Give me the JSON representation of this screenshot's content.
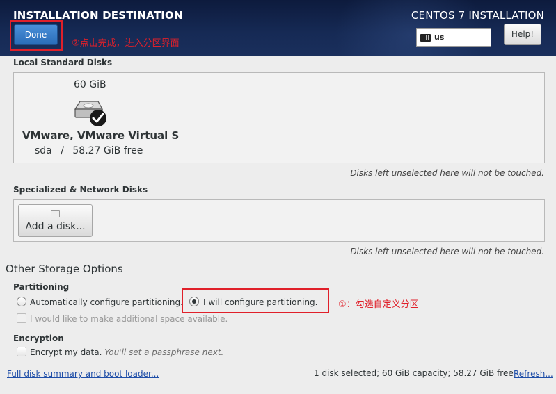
{
  "header": {
    "title": "INSTALLATION DESTINATION",
    "product": "CENTOS 7 INSTALLATION",
    "done_label": "Done",
    "done_annotation": "②点击完成，进入分区界面",
    "keyboard_layout": "us",
    "help_label": "Help!",
    "accent_color": "#e0202a"
  },
  "local_disks": {
    "section_label": "Local Standard Disks",
    "disk": {
      "size": "60 GiB",
      "name": "VMware, VMware Virtual S",
      "device": "sda",
      "separator": "/",
      "free": "58.27 GiB free",
      "icon": "harddisk-selected-icon"
    },
    "hint": "Disks left unselected here will not be touched."
  },
  "network_disks": {
    "section_label": "Specialized & Network Disks",
    "add_label": "Add a disk...",
    "hint": "Disks left unselected here will not be touched."
  },
  "other_options": {
    "title": "Other Storage Options",
    "partitioning": {
      "label": "Partitioning",
      "auto_label": "Automatically configure partitioning.",
      "manual_label": "I will configure partitioning.",
      "manual_annotation": "①：勾选自定义分区",
      "extra_space_label": "I would like to make additional space available.",
      "selected": "manual"
    },
    "encryption": {
      "label": "Encryption",
      "encrypt_label": "Encrypt my data.",
      "passphrase_hint": "You'll set a passphrase next."
    }
  },
  "footer": {
    "summary_link": "Full disk summary and boot loader...",
    "summary_text": "1 disk selected; 60 GiB capacity; 58.27 GiB free",
    "refresh_link": "Refresh..."
  }
}
